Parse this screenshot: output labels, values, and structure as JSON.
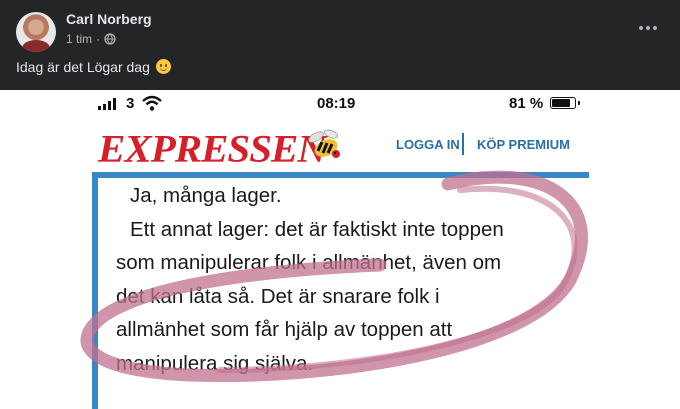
{
  "post": {
    "author": "Carl Norberg",
    "time": "1 tim",
    "privacy_icon": "globe-icon",
    "text": "Idag är det Lögar dag",
    "emoji": "smiling-face-emoji"
  },
  "screenshot": {
    "status_bar": {
      "carrier": "3",
      "time": "08:19",
      "battery": "81 %",
      "battery_level": 0.81
    },
    "brand": {
      "logo": "EXPRESSEN",
      "login": "LOGGA IN",
      "premium": "KÖP PREMIUM"
    },
    "article": {
      "line1": "Ja, många lager.",
      "line2": "Ett annat lager: det är faktiskt inte toppen",
      "line3": "som manipulerar folk i allmänhet, även om",
      "line4": "det kan låta så. Det är snarare folk i",
      "line5": "allmänhet som får hjälp av toppen att",
      "line6": "manipulera sig själva."
    },
    "colors": {
      "brand_red": "#d5202a",
      "link_blue": "#2b6fa8",
      "frame_blue": "#3a87c8",
      "highlight_pink": "#c0708f"
    }
  }
}
